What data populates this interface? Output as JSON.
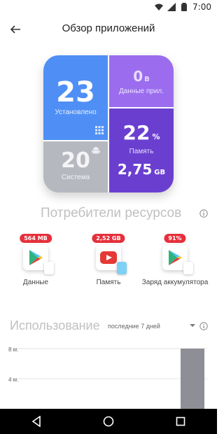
{
  "status_bar": {
    "time": "7:00"
  },
  "app_bar": {
    "title": "Обзор приложений"
  },
  "tiles": {
    "installed": {
      "value": "23",
      "label": "Установлено"
    },
    "app_data": {
      "value": "0",
      "unit": "B",
      "label": "Данные прил."
    },
    "memory": {
      "value": "22",
      "unit": "%",
      "label": "Память",
      "size": "2,75",
      "size_unit": "GB"
    },
    "system": {
      "value": "20",
      "label": "Система"
    }
  },
  "consumers_section": {
    "title": "Потребители ресурсов",
    "items": [
      {
        "badge": "564 MB",
        "label": "Данные",
        "icon": "play-store-icon"
      },
      {
        "badge": "2,52 GB",
        "label": "Память",
        "icon": "youtube-icon"
      },
      {
        "badge": "91%",
        "label": "Заряд аккумулятора",
        "icon": "play-store-icon"
      }
    ]
  },
  "usage_section": {
    "title": "Использование",
    "period": "последние 7 дней"
  },
  "chart_data": {
    "type": "bar",
    "ylabel_ticks": [
      "8 м.",
      "4 м."
    ],
    "values": [
      0,
      0,
      0,
      0,
      0,
      0,
      8
    ],
    "ylim": [
      0,
      8
    ],
    "grid": true
  },
  "colors": {
    "installed": "#4f8ff5",
    "app_data": "#9b6dee",
    "memory": "#6a3fd0",
    "system": "#b6b8c0",
    "badge": "#e5303b"
  }
}
